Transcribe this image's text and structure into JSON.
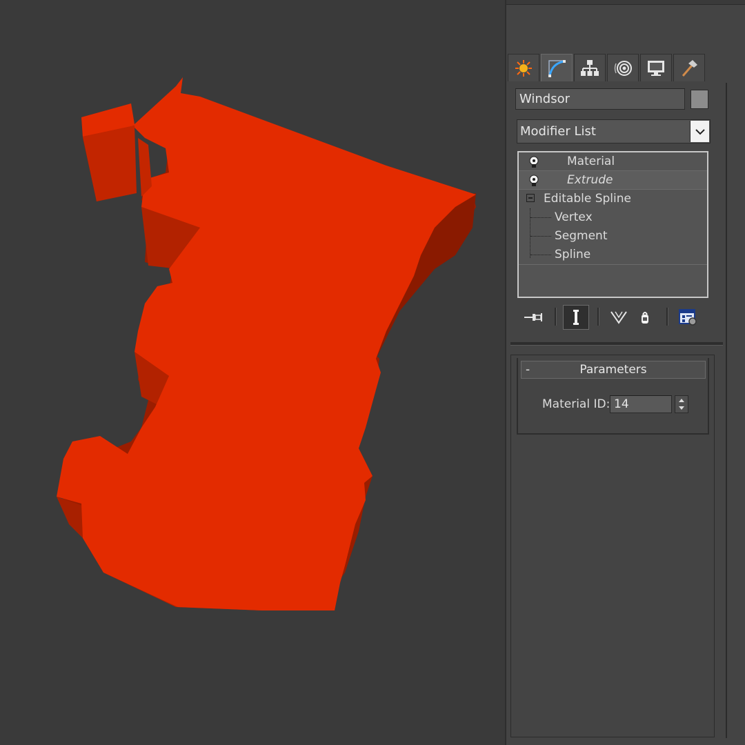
{
  "viewport": {
    "background": "#3a3a3a",
    "object_color": "#e32b00",
    "object_shade": "#b82300",
    "object_dark": "#8a1a00"
  },
  "command_panel": {
    "tabs": [
      {
        "name": "create-tab",
        "icon": "sun-icon"
      },
      {
        "name": "modify-tab",
        "icon": "modify-arc-icon",
        "active": true
      },
      {
        "name": "hierarchy-tab",
        "icon": "hierarchy-icon"
      },
      {
        "name": "motion-tab",
        "icon": "motion-icon"
      },
      {
        "name": "display-tab",
        "icon": "display-monitor-icon"
      },
      {
        "name": "utilities-tab",
        "icon": "hammer-icon"
      }
    ],
    "object_name": "Windsor",
    "object_color": "#8c8c8c",
    "modifier_list_label": "Modifier List",
    "stack": {
      "modifiers": [
        {
          "label": "Material",
          "icon": "lightbulb-icon"
        },
        {
          "label": "Extrude",
          "icon": "lightbulb-icon",
          "italic": true
        }
      ],
      "base_object": "Editable Spline",
      "sub_objects": [
        "Vertex",
        "Segment",
        "Spline"
      ]
    },
    "toolbar": [
      {
        "name": "pin-stack-button",
        "icon": "pin-icon"
      },
      {
        "name": "show-end-result-button",
        "icon": "end-result-icon",
        "pressed": true
      },
      {
        "name": "make-unique-button",
        "icon": "make-unique-icon"
      },
      {
        "name": "remove-modifier-button",
        "icon": "trash-icon"
      },
      {
        "name": "configure-modifier-sets-button",
        "icon": "configure-icon"
      }
    ],
    "parameters": {
      "title": "Parameters",
      "collapse_glyph": "-",
      "material_id_label": "Material ID:",
      "material_id_value": "14"
    }
  }
}
